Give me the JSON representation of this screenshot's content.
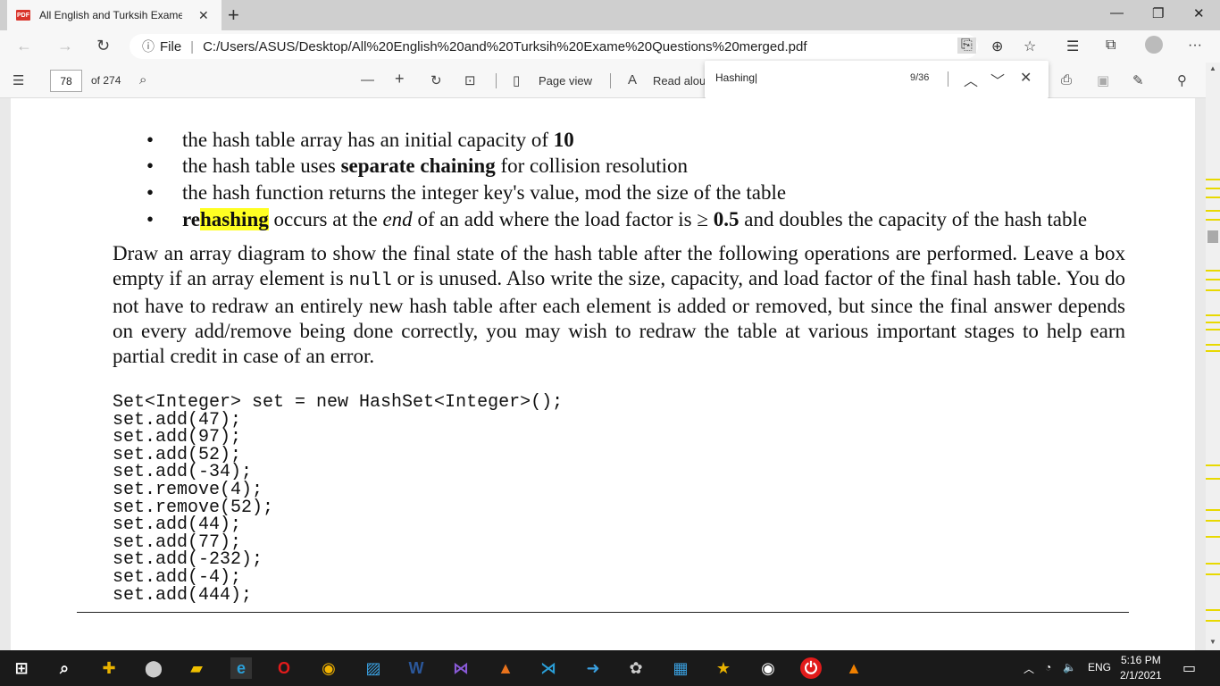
{
  "browser": {
    "tab_title": "All English and Turksih Exame Q",
    "tab_badge": "PDF",
    "address_prefix": "File",
    "url": "C:/Users/ASUS/Desktop/All%20English%20and%20Turksih%20Exame%20Questions%20merged.pdf"
  },
  "pdf_toolbar": {
    "page_current": "78",
    "page_total": "of 274",
    "page_view_label": "Page view",
    "read_aloud_label": "Read alou"
  },
  "find": {
    "query": "Hashing|",
    "count": "9/36"
  },
  "document": {
    "bullets": [
      {
        "pre": "the hash table array has an initial capacity of ",
        "bold": "10",
        "post": ""
      },
      {
        "pre": "the hash table uses ",
        "bold": "separate chaining",
        "post": " for collision resolution"
      },
      {
        "pre": "the hash function returns the integer key's value, mod the size of the table",
        "bold": "",
        "post": ""
      }
    ],
    "bullet4": {
      "re": "re",
      "hashing": "hashing",
      "mid": " occurs at the ",
      "end": "end",
      "mid2": " of an add where the load factor is ≥ ",
      "val": "0.5",
      "post": " and doubles the capacity of the hash table"
    },
    "para_a": "Draw an array diagram to show the final state of the hash table after the following operations are performed.  Leave a box empty if an array element is ",
    "para_null": "null",
    "para_b": " or is unused.  Also write the size, capacity, and load factor of the final hash table.  You do not have to redraw an entirely new hash table after each element is added or removed, but since the final answer depends on every add/remove being done correctly, you may wish to redraw the table at various important stages to help earn partial credit in case of an error.",
    "code": "Set<Integer> set = new HashSet<Integer>();\nset.add(47);\nset.add(97);\nset.add(52);\nset.add(-34);\nset.remove(4);\nset.remove(52);\nset.add(44);\nset.add(77);\nset.add(-232);\nset.add(-4);\nset.add(444);"
  },
  "taskbar": {
    "language": "ENG",
    "time": "5:16 PM",
    "date": "2/1/2021"
  },
  "colors": {
    "highlight": "#ffff22",
    "scroll_marker": "#e8d900"
  }
}
